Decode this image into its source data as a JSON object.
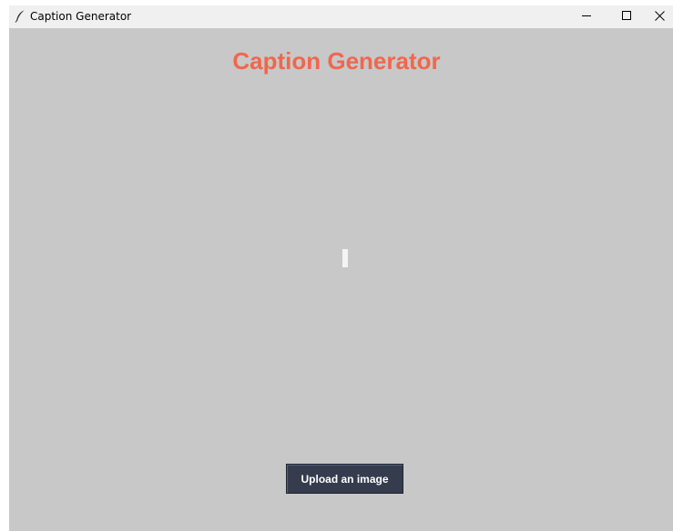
{
  "window": {
    "title": "Caption Generator",
    "icon": "feather-icon",
    "controls": {
      "minimize_icon": "minimize-icon",
      "maximize_icon": "maximize-icon",
      "close_icon": "close-icon"
    }
  },
  "main": {
    "heading": "Caption Generator",
    "upload_button_label": "Upload an image"
  },
  "colors": {
    "background": "#c8c8c8",
    "titlebar": "#f0f0f0",
    "heading": "#f0674d",
    "button_bg": "#353c4e",
    "button_text": "#ffffff",
    "image_placeholder": "#f4f4f4"
  }
}
